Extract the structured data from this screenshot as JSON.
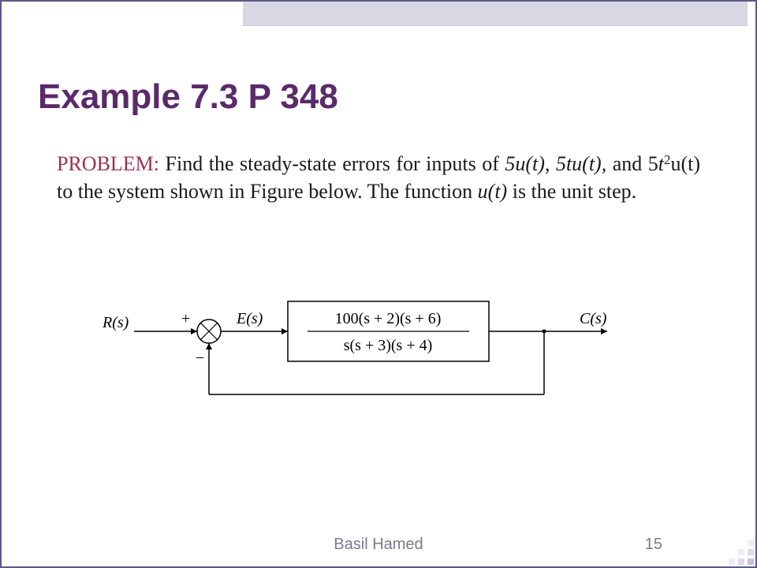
{
  "title": "Example 7.3 P 348",
  "problem_label": "PROBLEM:",
  "body_part1": " Find the steady-state errors for inputs of ",
  "input1": "5u(t),",
  "body_part2": " ",
  "input2": "5tu(t),",
  "body_part3": " and 5",
  "input3_var": "t",
  "input3_exp": "2",
  "input3_rest": "u(t)",
  "body_part4": " to the system shown in Figure below. The function ",
  "unit_step": "u(t)",
  "body_part5": " is the unit step.",
  "footer_author": "Basil Hamed",
  "page_number": "15",
  "diagram": {
    "input_label": "R(s)",
    "error_label": "E(s)",
    "output_label": "C(s)",
    "plus": "+",
    "minus": "−",
    "tf_numerator": "100(s + 2)(s + 6)",
    "tf_denominator": "s(s + 3)(s + 4)"
  }
}
